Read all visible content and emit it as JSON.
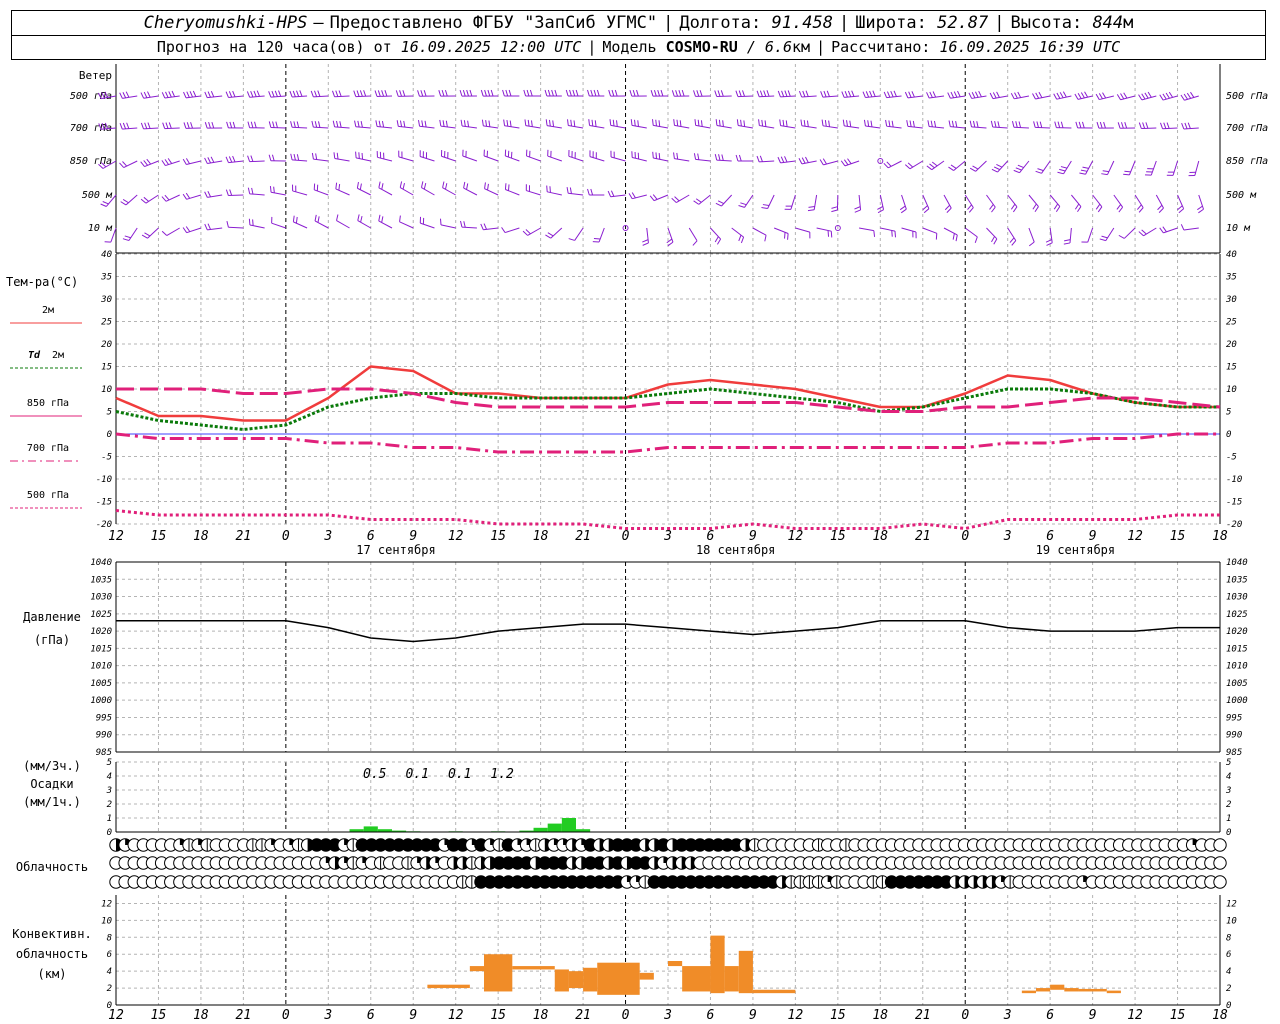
{
  "header": {
    "station": "Cheryomushki-HPS",
    "dash": "–",
    "provider": "Предоставлено ФГБУ \"ЗапСиб УГМС\"",
    "lon_label": "Долгота:",
    "lon_value": "91.458",
    "lat_label": "Широта:",
    "lat_value": "52.87",
    "alt_label": "Высота:",
    "alt_value": "844",
    "alt_unit": "м",
    "forecast_prefix": "Прогноз на 120 часа(ов) от",
    "forecast_start": "16.09.2025 12:00 UTC",
    "model_label": "Модель",
    "model_name": "COSMO-RU",
    "model_res": "/ 6.6",
    "model_unit": "км",
    "computed_label": "Рассчитано:",
    "computed_value": "16.09.2025 16:39 UTC"
  },
  "colors": {
    "t2m": "#f03c3c",
    "td2m": "#0a7a0a",
    "t850": "#e0207a",
    "t700": "#e0207a",
    "t500": "#e0207a",
    "wind": "#8a1ed0",
    "pressure": "#000000",
    "precip": "#22cc22",
    "convective": "#f08c28",
    "grid": "#b4b4b4",
    "zero_line": "#4040ff"
  },
  "time_axis": {
    "ticks": [
      "12",
      "15",
      "18",
      "21",
      "0",
      "3",
      "6",
      "9",
      "12",
      "15",
      "18",
      "21",
      "0",
      "3",
      "6",
      "9",
      "12",
      "15",
      "18",
      "21",
      "0",
      "3",
      "6",
      "9",
      "12",
      "15",
      "18"
    ],
    "day_labels": [
      {
        "text": "17 сентября",
        "index": 6.5
      },
      {
        "text": "18 сентября",
        "index": 14.5
      },
      {
        "text": "19 сентября",
        "index": 22.5
      }
    ],
    "midnights": [
      4,
      12,
      20
    ]
  },
  "wind_panel": {
    "title": "Ветер",
    "levels": [
      {
        "label": "500 гПа"
      },
      {
        "label": "700 гПа"
      },
      {
        "label": "850 гПа"
      },
      {
        "label": "500 м"
      },
      {
        "label": "10 м"
      }
    ]
  },
  "temp_panel": {
    "title": "Тем-ра(°С)",
    "ylim": [
      -20,
      40
    ],
    "ticks": [
      40,
      35,
      30,
      25,
      20,
      15,
      10,
      5,
      0,
      -5,
      -10,
      -15,
      -20
    ],
    "legend": [
      {
        "label": "2м",
        "key": "t2m"
      },
      {
        "label_it": "Td",
        "label": "2м",
        "key": "td2m"
      },
      {
        "label": "850 гПа",
        "key": "t850"
      },
      {
        "label": "700 гПа",
        "key": "t700"
      },
      {
        "label": "500 гПа",
        "key": "t500"
      }
    ]
  },
  "chart_data": [
    {
      "type": "line",
      "panel": "temperature",
      "x": [
        0,
        1,
        2,
        3,
        4,
        5,
        6,
        7,
        8,
        9,
        10,
        11,
        12,
        13,
        14,
        15,
        16,
        17,
        18,
        19,
        20,
        21,
        22,
        23,
        24,
        25,
        26
      ],
      "series": [
        {
          "name": "2м",
          "values": [
            8,
            4,
            4,
            3,
            3,
            8,
            15,
            14,
            9,
            9,
            8,
            8,
            8,
            11,
            12,
            11,
            10,
            8,
            6,
            6,
            9,
            13,
            12,
            9,
            7,
            6,
            6
          ]
        },
        {
          "name": "Td 2м",
          "values": [
            5,
            3,
            2,
            1,
            2,
            6,
            8,
            9,
            9,
            8,
            8,
            8,
            8,
            9,
            10,
            9,
            8,
            7,
            5,
            6,
            8,
            10,
            10,
            9,
            7,
            6,
            6
          ]
        },
        {
          "name": "850 гПа",
          "values": [
            10,
            10,
            10,
            9,
            9,
            10,
            10,
            9,
            7,
            6,
            6,
            6,
            6,
            7,
            7,
            7,
            7,
            6,
            5,
            5,
            6,
            6,
            7,
            8,
            8,
            7,
            6
          ]
        },
        {
          "name": "700 гПа",
          "values": [
            0,
            -1,
            -1,
            -1,
            -1,
            -2,
            -2,
            -3,
            -3,
            -4,
            -4,
            -4,
            -4,
            -3,
            -3,
            -3,
            -3,
            -3,
            -3,
            -3,
            -3,
            -2,
            -2,
            -1,
            -1,
            0,
            0
          ]
        },
        {
          "name": "500 гПа",
          "values": [
            -17,
            -18,
            -18,
            -18,
            -18,
            -18,
            -19,
            -19,
            -19,
            -20,
            -20,
            -20,
            -21,
            -21,
            -21,
            -20,
            -21,
            -21,
            -21,
            -20,
            -21,
            -19,
            -19,
            -19,
            -19,
            -18,
            -18
          ]
        }
      ],
      "ylim": [
        -20,
        40
      ]
    },
    {
      "type": "line",
      "panel": "pressure",
      "title": "Давление",
      "ylabel": "(гПа)",
      "x": [
        0,
        1,
        2,
        3,
        4,
        5,
        6,
        7,
        8,
        9,
        10,
        11,
        12,
        13,
        14,
        15,
        16,
        17,
        18,
        19,
        20,
        21,
        22,
        23,
        24,
        25,
        26
      ],
      "series": [
        {
          "values": [
            1023,
            1023,
            1023,
            1023,
            1023,
            1021,
            1018,
            1017,
            1018,
            1020,
            1021,
            1022,
            1022,
            1021,
            1020,
            1019,
            1020,
            1021,
            1023,
            1023,
            1023,
            1021,
            1020,
            1020,
            1020,
            1021,
            1021
          ]
        }
      ],
      "ylim": [
        985,
        1040
      ],
      "ticks": [
        1040,
        1035,
        1030,
        1025,
        1020,
        1015,
        1010,
        1005,
        1000,
        995,
        990,
        985
      ]
    },
    {
      "type": "bar",
      "panel": "precipitation",
      "title": "Осадки",
      "ylabel_top": "(мм/3ч.)",
      "ylabel_bottom": "(мм/1ч.)",
      "ylim": [
        0,
        5
      ],
      "ticks": [
        5,
        4,
        3,
        2,
        1,
        0
      ],
      "hourly": [
        {
          "t": 17.0,
          "v": 0.2
        },
        {
          "t": 18.0,
          "v": 0.4
        },
        {
          "t": 19.0,
          "v": 0.2
        },
        {
          "t": 20.0,
          "v": 0.1
        },
        {
          "t": 21.0,
          "v": 0.05
        },
        {
          "t": 24.0,
          "v": 0.05
        },
        {
          "t": 27.0,
          "v": 0.05
        },
        {
          "t": 29.0,
          "v": 0.1
        },
        {
          "t": 30.0,
          "v": 0.3
        },
        {
          "t": 31.0,
          "v": 0.6
        },
        {
          "t": 32.0,
          "v": 1.0
        },
        {
          "t": 33.0,
          "v": 0.2
        }
      ],
      "labels_3h": [
        {
          "t": 18.0,
          "text": "0.5"
        },
        {
          "t": 21.0,
          "text": "0.1"
        },
        {
          "t": 24.0,
          "text": "0.1"
        },
        {
          "t": 27.0,
          "text": "1.2"
        }
      ]
    },
    {
      "type": "bar",
      "panel": "convective_cloud",
      "title": "Конвективн. облачность",
      "ylabel": "(км)",
      "ylim": [
        0,
        13
      ],
      "ticks": [
        12,
        10,
        8,
        6,
        4,
        2,
        0
      ],
      "bars": [
        {
          "t0": 22,
          "t1": 25,
          "bottom": 2.0,
          "top": 2.4
        },
        {
          "t0": 25,
          "t1": 26,
          "bottom": 4.0,
          "top": 4.6
        },
        {
          "t0": 26,
          "t1": 28,
          "bottom": 1.6,
          "top": 6.0
        },
        {
          "t0": 28,
          "t1": 31,
          "bottom": 4.2,
          "top": 4.6
        },
        {
          "t0": 31,
          "t1": 32,
          "bottom": 1.6,
          "top": 4.2
        },
        {
          "t0": 32,
          "t1": 33,
          "bottom": 2.0,
          "top": 4.0
        },
        {
          "t0": 33,
          "t1": 34,
          "bottom": 1.6,
          "top": 4.4
        },
        {
          "t0": 34,
          "t1": 37,
          "bottom": 1.2,
          "top": 5.0
        },
        {
          "t0": 37,
          "t1": 38,
          "bottom": 3.0,
          "top": 3.8
        },
        {
          "t0": 39,
          "t1": 40,
          "bottom": 4.6,
          "top": 5.2
        },
        {
          "t0": 40,
          "t1": 42,
          "bottom": 1.6,
          "top": 4.6
        },
        {
          "t0": 42,
          "t1": 43,
          "bottom": 1.4,
          "top": 8.2
        },
        {
          "t0": 43,
          "t1": 44,
          "bottom": 1.6,
          "top": 4.6
        },
        {
          "t0": 44,
          "t1": 45,
          "bottom": 1.4,
          "top": 6.4
        },
        {
          "t0": 45,
          "t1": 48,
          "bottom": 1.4,
          "top": 1.8
        },
        {
          "t0": 64,
          "t1": 65,
          "bottom": 1.4,
          "top": 1.7
        },
        {
          "t0": 65,
          "t1": 66,
          "bottom": 1.6,
          "top": 2.0
        },
        {
          "t0": 66,
          "t1": 67,
          "bottom": 1.8,
          "top": 2.4
        },
        {
          "t0": 67,
          "t1": 68,
          "bottom": 1.6,
          "top": 2.0
        },
        {
          "t0": 68,
          "t1": 70,
          "bottom": 1.6,
          "top": 1.9
        },
        {
          "t0": 70,
          "t1": 71,
          "bottom": 1.4,
          "top": 1.7
        }
      ]
    }
  ],
  "cloud_panel": {
    "title": "Облачность",
    "rows": [
      [
        3,
        2,
        0,
        0,
        0,
        0,
        0,
        2,
        1,
        2,
        1,
        0,
        0,
        0,
        0,
        1,
        1,
        2,
        0,
        2,
        1,
        3,
        4,
        4,
        4,
        2,
        1,
        4,
        4,
        4,
        4,
        4,
        4,
        4,
        4,
        4,
        2,
        4,
        4,
        2,
        4,
        2,
        1,
        4,
        2,
        2,
        1,
        3,
        2,
        2,
        3,
        2,
        4,
        3,
        3,
        4,
        4,
        4,
        3,
        3,
        4,
        3,
        4,
        4,
        4,
        4,
        4,
        4,
        4,
        3,
        1,
        0,
        0,
        0,
        0,
        0,
        0,
        1,
        0,
        0,
        1,
        0,
        0,
        0,
        0,
        0,
        0,
        0,
        0,
        0,
        0,
        0,
        0,
        0,
        0,
        0,
        0,
        0,
        0,
        0,
        0,
        0,
        0,
        0,
        0,
        0,
        0,
        0,
        0,
        0,
        0,
        0,
        0,
        0,
        0,
        0,
        0,
        0,
        2,
        0,
        0,
        0
      ],
      [
        0,
        0,
        0,
        0,
        0,
        0,
        0,
        0,
        0,
        0,
        0,
        0,
        0,
        0,
        0,
        0,
        0,
        0,
        0,
        0,
        0,
        0,
        0,
        2,
        3,
        2,
        1,
        2,
        0,
        1,
        0,
        0,
        1,
        2,
        3,
        2,
        0,
        3,
        3,
        1,
        3,
        3,
        4,
        4,
        4,
        4,
        3,
        4,
        4,
        4,
        3,
        3,
        4,
        4,
        3,
        4,
        3,
        4,
        4,
        3,
        2,
        3,
        3,
        3,
        0,
        0,
        0,
        0,
        0,
        0,
        0,
        0,
        0,
        0,
        0,
        0,
        0,
        0,
        0,
        0,
        0,
        0,
        0,
        0,
        0,
        0,
        0,
        0,
        0,
        0,
        0,
        0,
        0,
        0,
        0,
        0,
        0,
        0,
        0,
        0,
        0,
        0,
        0,
        0,
        0,
        0,
        0,
        0,
        0,
        0,
        0,
        0,
        0,
        0,
        0,
        0,
        0,
        0,
        0,
        0,
        0,
        0
      ],
      [
        0,
        0,
        0,
        0,
        0,
        0,
        0,
        0,
        0,
        0,
        0,
        0,
        0,
        0,
        0,
        0,
        0,
        0,
        0,
        0,
        0,
        0,
        0,
        0,
        0,
        0,
        0,
        0,
        0,
        0,
        0,
        0,
        0,
        0,
        0,
        0,
        0,
        0,
        1,
        1,
        4,
        4,
        4,
        4,
        4,
        4,
        4,
        4,
        4,
        4,
        4,
        4,
        4,
        4,
        4,
        4,
        2,
        2,
        1,
        4,
        4,
        4,
        4,
        4,
        4,
        4,
        4,
        4,
        4,
        4,
        4,
        4,
        4,
        3,
        1,
        1,
        1,
        1,
        2,
        1,
        0,
        0,
        0,
        1,
        1,
        4,
        4,
        4,
        4,
        4,
        4,
        4,
        3,
        3,
        3,
        3,
        3,
        2,
        1,
        0,
        0,
        0,
        0,
        0,
        0,
        0,
        2,
        0,
        0,
        0,
        0,
        0,
        0,
        0,
        0,
        0,
        0,
        0,
        0,
        0,
        0,
        0
      ]
    ]
  }
}
